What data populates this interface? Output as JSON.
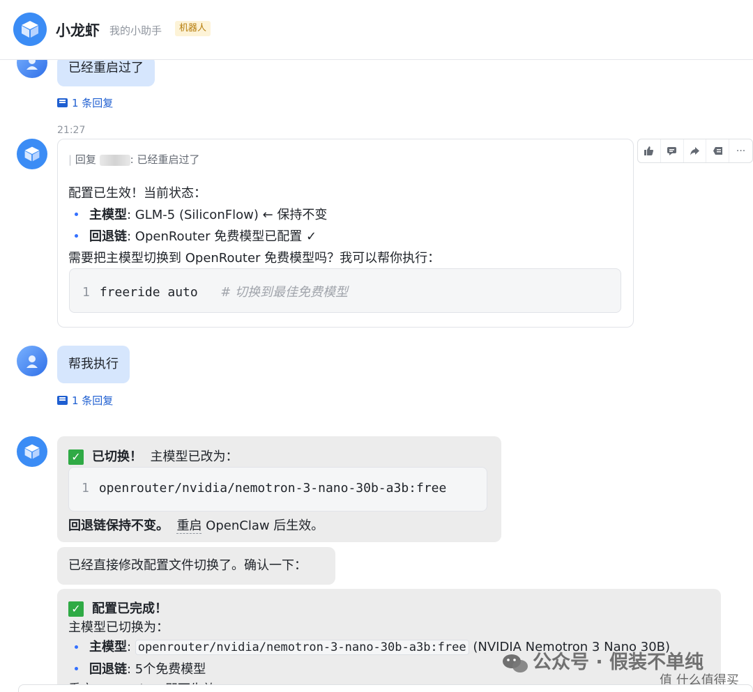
{
  "header": {
    "title": "小龙虾",
    "subtitle": "我的小助手",
    "badge": "机器人"
  },
  "messages": {
    "user1": {
      "text": "已经重启过了",
      "replies": "1 条回复"
    },
    "bot1": {
      "time": "21:27",
      "quote_prefix": "回复",
      "quote_text": "已经重启过了",
      "line1": "配置已生效！当前状态：",
      "b1_label": "主模型",
      "b1_text": ": GLM-5 (SiliconFlow) ← 保持不变",
      "b2_label": "回退链",
      "b2_text": ": OpenRouter 免费模型已配置 ✓",
      "line2": "需要把主模型切换到 OpenRouter 免费模型吗？我可以帮你执行：",
      "code_ln": "1",
      "code": "freeride auto",
      "code_comment": "# 切换到最佳免费模型"
    },
    "user2": {
      "text": "帮我执行",
      "replies": "1 条回复"
    },
    "bot2": {
      "title": "已切换！",
      "title_rest": "主模型已改为：",
      "code_ln": "1",
      "code": "openrouter/nvidia/nemotron-3-nano-30b-a3b:free",
      "footer_bold": "回退链保持不变。",
      "footer_restart": "重启",
      "footer_rest": " OpenClaw 后生效。"
    },
    "bot3": {
      "text": "已经直接修改配置文件切换了。确认一下："
    },
    "bot4": {
      "title": "配置已完成！",
      "line1": "主模型已切换为：",
      "b1_label": "主模型",
      "b1_code": "openrouter/nvidia/nemotron-3-nano-30b-a3b:free",
      "b1_rest": " (NVIDIA Nemotron 3 Nano 30B)",
      "b2_label": "回退链",
      "b2_text": ": 5个免费模型",
      "partial": "重启 OpenClaw 即可生效"
    }
  },
  "toolbar": {
    "icons": [
      "thumbs-up-icon",
      "comment-icon",
      "forward-icon",
      "mark-icon",
      "more-icon"
    ],
    "more_label": "···"
  },
  "watermark": {
    "main": "公众号 · 假装不单纯",
    "sub": "值 什么值得买"
  }
}
